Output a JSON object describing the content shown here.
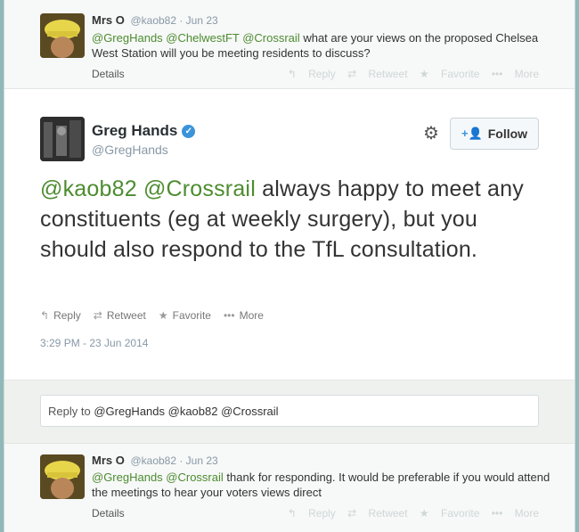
{
  "top_tweet": {
    "name": "Mrs O",
    "handle_date": "@kaob82 · Jun 23",
    "mentions": "@GregHands @ChelwestFT @Crossrail",
    "text": "what are your views on the proposed Chelsea West Station will you be meeting residents to discuss?",
    "details": "Details",
    "actions": [
      "Reply",
      "Retweet",
      "Favorite",
      "More"
    ]
  },
  "main_tweet": {
    "name": "Greg Hands",
    "handle": "@GregHands",
    "follow_label": "Follow",
    "mentions": "@kaob82 @Crossrail",
    "text": "always happy to meet any constituents (eg at weekly surgery), but you should also respond to the TfL consultation.",
    "actions": [
      "Reply",
      "Retweet",
      "Favorite",
      "More"
    ],
    "timestamp": "3:29 PM - 23 Jun 2014"
  },
  "reply_box": {
    "prefix": "Reply to",
    "mentions": "@GregHands @kaob82 @Crossrail"
  },
  "bottom_tweet": {
    "name": "Mrs O",
    "handle_date": "@kaob82 · Jun 23",
    "mentions": "@GregHands @Crossrail",
    "text": "thank for responding. It would be preferable if you would attend the meetings to hear your voters views direct",
    "details": "Details",
    "actions": [
      "Reply",
      "Retweet",
      "Favorite",
      "More"
    ]
  },
  "colors": {
    "mention": "#4d8c2f",
    "verified": "#3b94d9",
    "background": "#8fb9b8"
  }
}
